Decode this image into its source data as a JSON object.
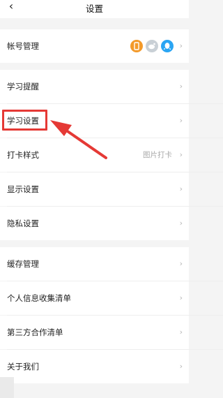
{
  "header": {
    "back_icon": "chevron-left-icon",
    "title": "设置"
  },
  "rows": {
    "account": {
      "label": "帐号管理",
      "icons": [
        "phone-icon",
        "weibo-icon",
        "qq-icon"
      ]
    },
    "study_reminder": {
      "label": "学习提醒"
    },
    "study_settings": {
      "label": "学习设置"
    },
    "checkin_style": {
      "label": "打卡样式",
      "value": "图片打卡"
    },
    "display_settings": {
      "label": "显示设置"
    },
    "privacy_settings": {
      "label": "隐私设置"
    },
    "cache_management": {
      "label": "缓存管理"
    },
    "personal_info_list": {
      "label": "个人信息收集清单"
    },
    "third_party_list": {
      "label": "第三方合作清单"
    },
    "about_us": {
      "label": "关于我们"
    }
  },
  "chevron": "›",
  "colors": {
    "highlight": "#e53935",
    "phone_icon": "#f39a2b",
    "weibo_icon": "#c9d0d6",
    "qq_icon": "#2aa5f3"
  }
}
